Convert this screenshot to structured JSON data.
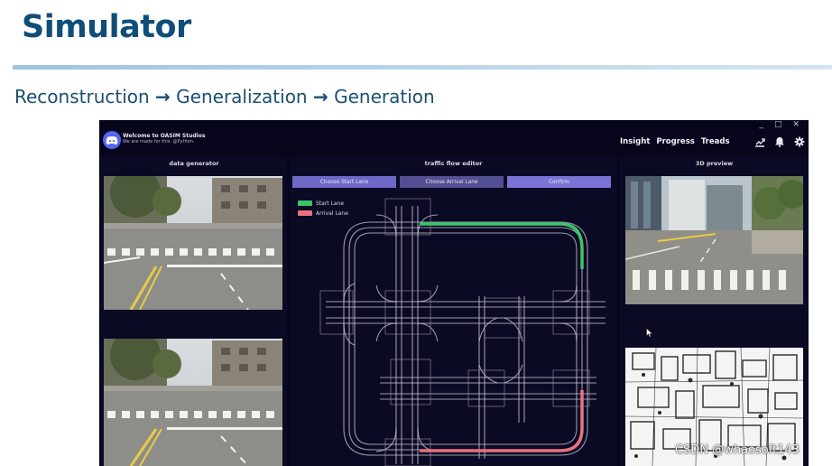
{
  "slide": {
    "title": "Simulator",
    "subtitle_steps": [
      "Reconstruction",
      "Generalization",
      "Generation"
    ],
    "arrow": "→"
  },
  "app": {
    "welcome_title": "Welcome to OASIM Studios",
    "welcome_subtitle": "We are made for this. @Python.",
    "window_controls": [
      "_",
      "□",
      "✕"
    ],
    "nav": [
      "Insight",
      "Progress",
      "Treads"
    ],
    "top_icons": [
      "chart-icon",
      "bell-icon",
      "gear-icon"
    ],
    "panels": {
      "data_generator": "data generator",
      "traffic_flow_editor": "traffic flow editor",
      "preview_3d": "3D preview"
    },
    "buttons": {
      "start_lane": "Choose Start Lane",
      "arrival_lane": "Choose Arrival Lane",
      "confirm": "Confirm"
    },
    "legend": [
      {
        "label": "Start Lane",
        "color": "#3cc46a"
      },
      {
        "label": "Arrival Lane",
        "color": "#e8727e"
      }
    ]
  },
  "colors": {
    "title": "#0f4d7a",
    "app_bg": "#06051b",
    "accent_button": "#6f68c6",
    "start_lane": "#3cc46a",
    "arrival_lane": "#e8727e"
  },
  "watermark": "CSDN @whaosoft143"
}
